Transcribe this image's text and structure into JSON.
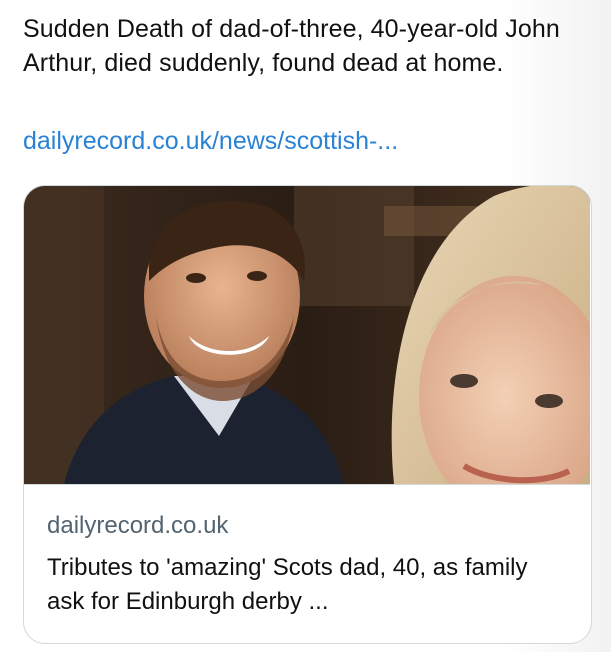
{
  "post": {
    "text": "Sudden Death of dad-of-three, 40-year-old John Arthur, died suddenly, found dead at home.",
    "link_text": "dailyrecord.co.uk/news/scottish-..."
  },
  "card": {
    "domain": "dailyrecord.co.uk",
    "title": "Tributes to 'amazing' Scots dad, 40, as family ask for Edinburgh derby ...",
    "image_description_icon": "photo-thumbnail"
  },
  "colors": {
    "link": "#2a82d4",
    "border": "#cfd9de",
    "muted_text": "#536471"
  }
}
